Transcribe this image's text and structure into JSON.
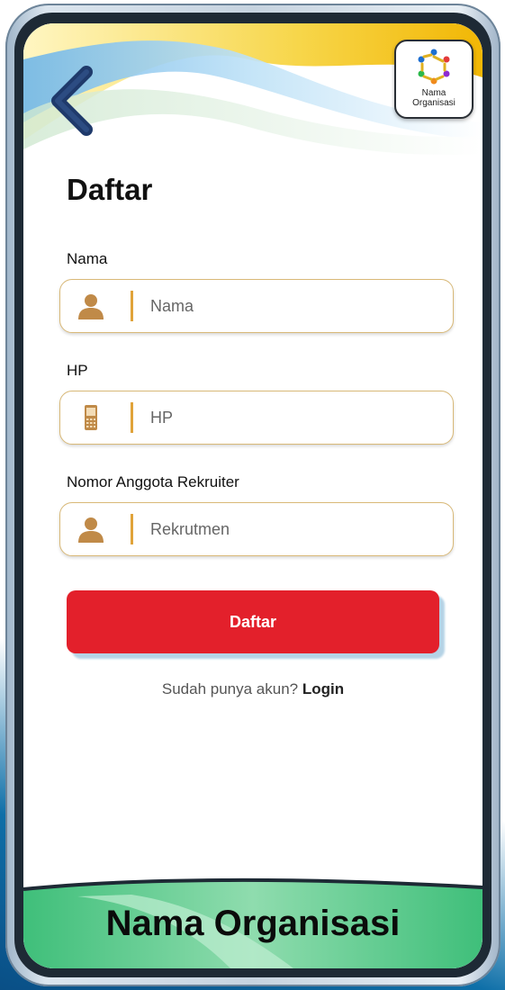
{
  "header": {
    "back_icon": "chevron-left-icon",
    "logo_text_line1": "Nama",
    "logo_text_line2": "Organisasi"
  },
  "form": {
    "title": "Daftar",
    "fields": [
      {
        "label": "Nama",
        "placeholder": "Nama",
        "value": "",
        "icon": "person-icon"
      },
      {
        "label": "HP",
        "placeholder": "HP",
        "value": "",
        "icon": "mobile-phone-icon"
      },
      {
        "label": "Nomor Anggota Rekruiter",
        "placeholder": "Rekrutmen",
        "value": "",
        "icon": "person-icon"
      }
    ],
    "submit_label": "Daftar"
  },
  "login_prompt": {
    "text": "Sudah punya akun?",
    "link": "Login"
  },
  "footer": {
    "org_name": "Nama Organisasi"
  },
  "colors": {
    "accent_red": "#e3202b",
    "field_border": "#d9b978",
    "icon_gold": "#c08a48",
    "separator_orange": "#e0a33a",
    "footer_green": "#5cc98a",
    "back_arrow_navy": "#1f3a6b"
  }
}
